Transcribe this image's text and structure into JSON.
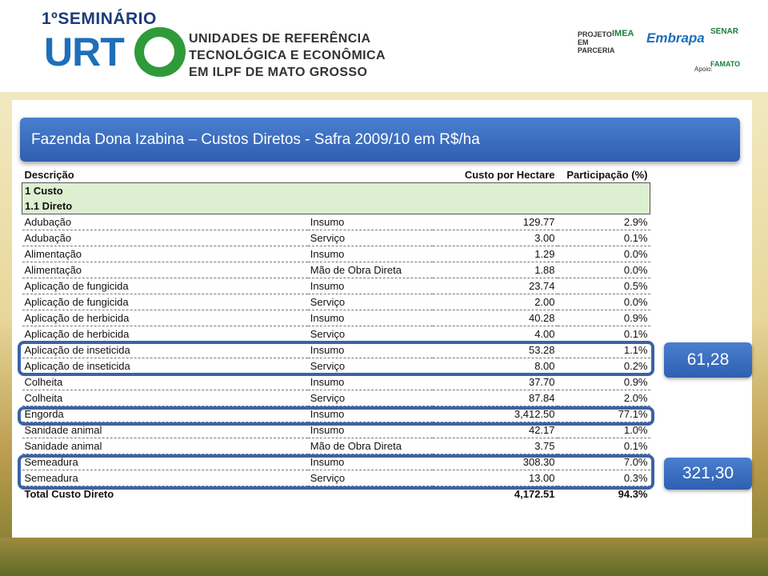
{
  "header": {
    "seminar": "1ºSEMINÁRIO",
    "logo_text": "URT",
    "title_lines": [
      "UNIDADES DE REFERÊNCIA",
      "TECNOLÓGICA E ECONÔMICA",
      "EM ILPF DE MATO GROSSO"
    ],
    "partner_label": "PROJETO EM PARCERIA",
    "partners": [
      "IMEA",
      "Embrapa",
      "SENAR"
    ],
    "apoio_label": "Apoio:",
    "apoio_partner": "FAMATO"
  },
  "slide": {
    "title": "Fazenda Dona Izabina – Custos Diretos - Safra 2009/10 em R$/ha",
    "columns": [
      "Descrição",
      "",
      "Custo por Hectare",
      "Participação (%)"
    ],
    "section_rows": [
      "1 Custo",
      "1.1 Direto"
    ],
    "rows": [
      [
        "Adubação",
        "Insumo",
        "129.77",
        "2.9%"
      ],
      [
        "Adubação",
        "Serviço",
        "3.00",
        "0.1%"
      ],
      [
        "Alimentação",
        "Insumo",
        "1.29",
        "0.0%"
      ],
      [
        "Alimentação",
        "Mão de Obra Direta",
        "1.88",
        "0.0%"
      ],
      [
        "Aplicação de fungicida",
        "Insumo",
        "23.74",
        "0.5%"
      ],
      [
        "Aplicação de fungicida",
        "Serviço",
        "2.00",
        "0.0%"
      ],
      [
        "Aplicação de herbicida",
        "Insumo",
        "40.28",
        "0.9%"
      ],
      [
        "Aplicação de herbicida",
        "Serviço",
        "4.00",
        "0.1%"
      ],
      [
        "Aplicação de inseticida",
        "Insumo",
        "53.28",
        "1.1%"
      ],
      [
        "Aplicação de inseticida",
        "Serviço",
        "8.00",
        "0.2%"
      ],
      [
        "Colheita",
        "Insumo",
        "37.70",
        "0.9%"
      ],
      [
        "Colheita",
        "Serviço",
        "87.84",
        "2.0%"
      ],
      [
        "Engorda",
        "Insumo",
        "3,412.50",
        "77.1%"
      ],
      [
        "Sanidade animal",
        "Insumo",
        "42.17",
        "1.0%"
      ],
      [
        "Sanidade animal",
        "Mão de Obra Direta",
        "3.75",
        "0.1%"
      ],
      [
        "Semeadura",
        "Insumo",
        "308.30",
        "7.0%"
      ],
      [
        "Semeadura",
        "Serviço",
        "13.00",
        "0.3%"
      ]
    ],
    "total": [
      "Total Custo Direto",
      "",
      "4,172.51",
      "94.3%"
    ],
    "callouts": [
      "61,28",
      "321,30"
    ]
  }
}
